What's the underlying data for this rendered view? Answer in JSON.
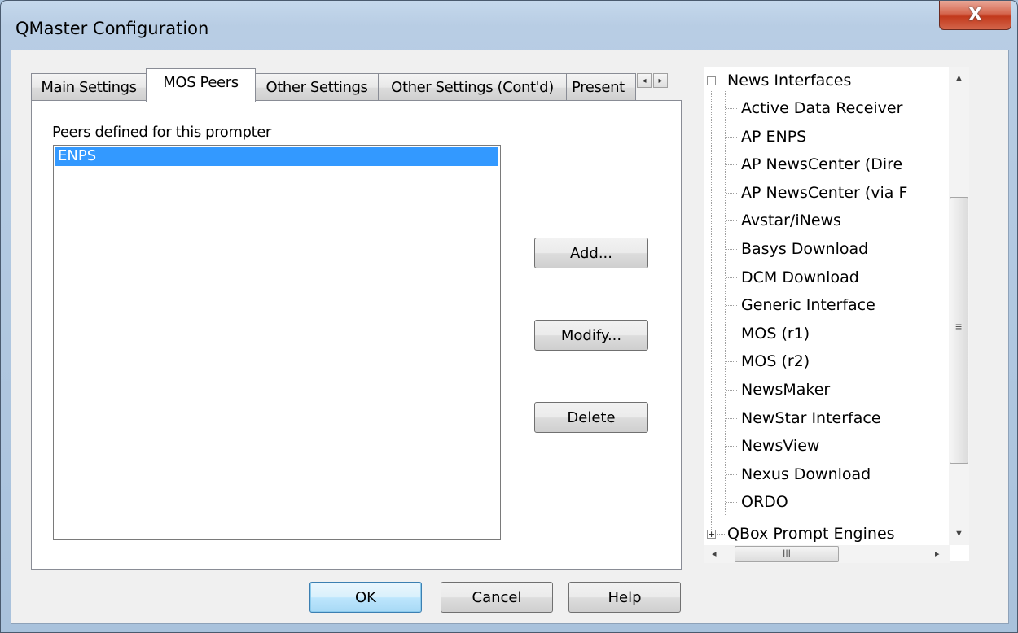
{
  "window": {
    "title": "QMaster Configuration",
    "close_glyph": "X"
  },
  "tabs": [
    {
      "label": "Main Settings"
    },
    {
      "label": "MOS Peers",
      "active": true
    },
    {
      "label": "Other Settings"
    },
    {
      "label": "Other Settings (Cont'd)"
    },
    {
      "label": "Present"
    }
  ],
  "tab_scroll": {
    "left_glyph": "◂",
    "right_glyph": "▸"
  },
  "peers": {
    "label": "Peers defined for this prompter",
    "items": [
      "ENPS"
    ],
    "selected": "ENPS"
  },
  "actions": {
    "add": "Add...",
    "modify": "Modify...",
    "delete": "Delete"
  },
  "footer": {
    "ok": "OK",
    "cancel": "Cancel",
    "help": "Help"
  },
  "tree": {
    "root_label": "News Interfaces",
    "root_expander": "−",
    "children": [
      "Active Data Receiver",
      "AP ENPS",
      "AP NewsCenter (Dire",
      "AP NewsCenter (via F",
      "Avstar/iNews",
      "Basys Download",
      "DCM Download",
      "Generic Interface",
      "MOS (r1)",
      "MOS (r2)",
      "NewsMaker",
      "NewStar Interface",
      "NewsView",
      "Nexus Download",
      "ORDO"
    ],
    "next_root_label": "QBox Prompt Engines",
    "next_root_expander": "+"
  },
  "scrollbars": {
    "up": "▲",
    "down": "▼",
    "left": "◂",
    "right": "▸",
    "v_grip": "≡",
    "h_grip": "III"
  },
  "colors": {
    "selection": "#3399ff",
    "close_button": "#c2391c",
    "default_button": "#bee6fd"
  }
}
